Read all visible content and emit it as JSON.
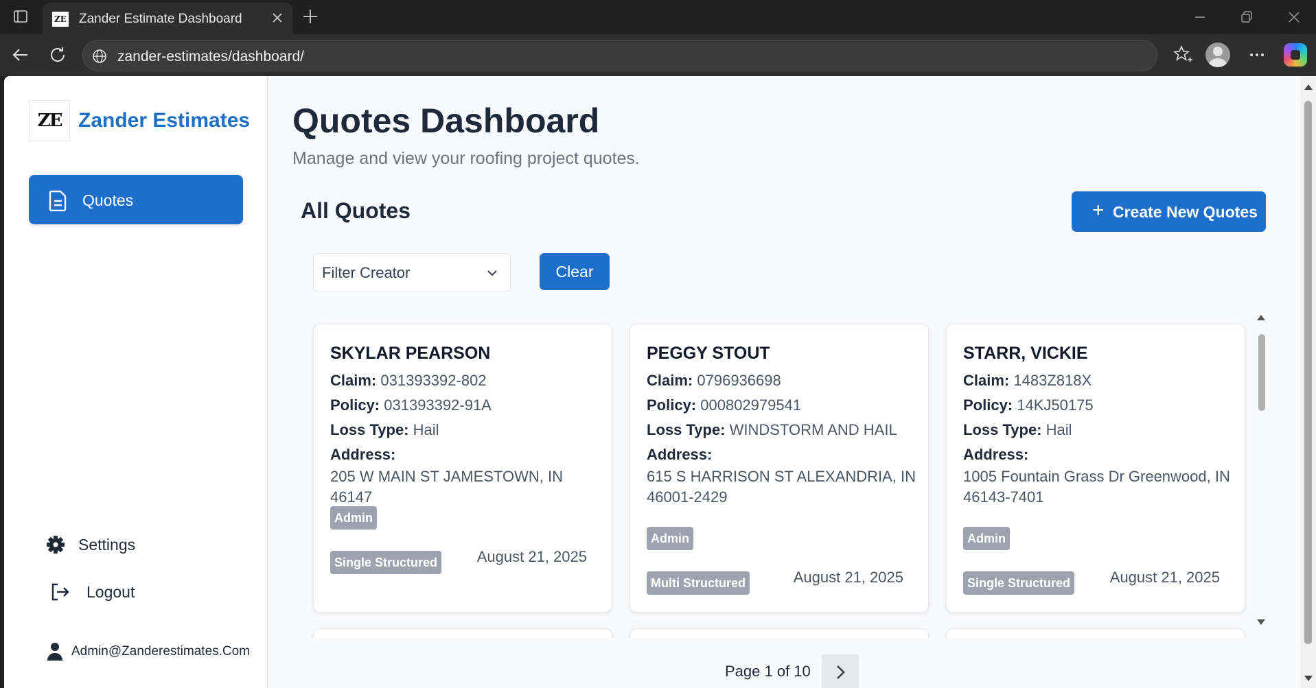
{
  "browser": {
    "tab_title": "Zander Estimate Dashboard",
    "favicon_text": "ZE",
    "url": "zander-estimates/dashboard/"
  },
  "sidebar": {
    "logo_text": "ZE",
    "brand": "Zander Estimates",
    "nav_quotes": "Quotes",
    "settings": "Settings",
    "logout": "Logout",
    "user": "Admin@Zanderestimates.Com"
  },
  "main": {
    "title": "Quotes Dashboard",
    "subtitle": "Manage and view your roofing project quotes.",
    "section_title": "All Quotes",
    "create_button": "Create New Quotes",
    "filter_placeholder": "Filter Creator",
    "clear_button": "Clear"
  },
  "labels": {
    "claim": "Claim:",
    "policy": "Policy:",
    "loss_type": "Loss Type:",
    "address": "Address:"
  },
  "quotes": [
    {
      "name": "SKYLAR PEARSON",
      "claim": "031393392-802",
      "policy": "031393392-91A",
      "loss_type": "Hail",
      "address": "205 W MAIN ST JAMESTOWN, IN 46147",
      "creator": "Admin",
      "structure": "Single Structured",
      "date": "August 21, 2025"
    },
    {
      "name": "PEGGY STOUT",
      "claim": "0796936698",
      "policy": "000802979541",
      "loss_type": "WINDSTORM AND HAIL",
      "address": "615 S HARRISON ST ALEXANDRIA, IN 46001-2429",
      "creator": "Admin",
      "structure": "Multi Structured",
      "date": "August 21, 2025"
    },
    {
      "name": "STARR, VICKIE",
      "claim": "1483Z818X",
      "policy": "14KJ50175",
      "loss_type": "Hail",
      "address": "1005 Fountain Grass Dr Greenwood, IN 46143-7401",
      "creator": "Admin",
      "structure": "Single Structured",
      "date": "August 21, 2025"
    }
  ],
  "pagination": {
    "text": "Page 1 of 10",
    "current": 1,
    "total": 10
  },
  "colors": {
    "primary": "#1e6fcb",
    "brand_text": "#1d6fc4",
    "badge": "#9ca3af"
  },
  "icons": {
    "quotes": "document-icon",
    "settings": "gear-icon",
    "logout": "logout-icon",
    "user": "user-icon",
    "next": "chevron-right-icon",
    "filter": "chevron-down-icon"
  }
}
